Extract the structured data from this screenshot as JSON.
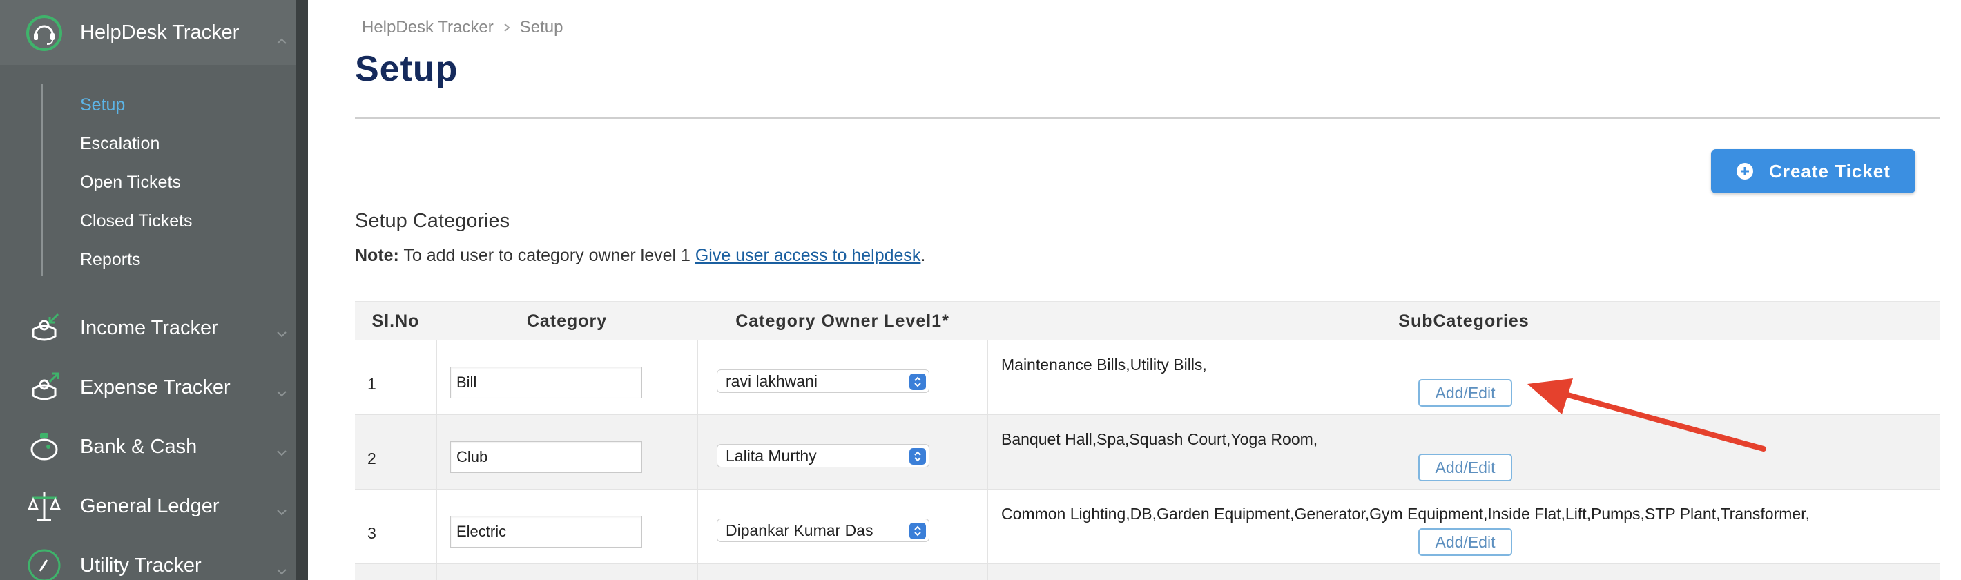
{
  "sidebar": {
    "app": {
      "label": "HelpDesk Tracker",
      "icon": "headset-icon"
    },
    "submenu": [
      {
        "label": "Setup",
        "active": true
      },
      {
        "label": "Escalation",
        "active": false
      },
      {
        "label": "Open Tickets",
        "active": false
      },
      {
        "label": "Closed Tickets",
        "active": false
      },
      {
        "label": "Reports",
        "active": false
      }
    ],
    "items": [
      {
        "label": "Income Tracker",
        "icon": "income-icon"
      },
      {
        "label": "Expense Tracker",
        "icon": "expense-icon"
      },
      {
        "label": "Bank & Cash",
        "icon": "piggy-bank-icon"
      },
      {
        "label": "General Ledger",
        "icon": "scale-icon"
      },
      {
        "label": "Utility Tracker",
        "icon": "gauge-icon"
      }
    ]
  },
  "breadcrumb": {
    "root": "HelpDesk Tracker",
    "current": "Setup"
  },
  "page": {
    "title": "Setup",
    "create_button": "Create Ticket",
    "section_title": "Setup Categories",
    "note_label": "Note:",
    "note_text": "To add user to category owner level 1",
    "note_link": "Give user access to helpdesk",
    "note_end": "."
  },
  "table": {
    "headers": {
      "no": "Sl.No",
      "category": "Category",
      "owner": "Category Owner Level1*",
      "subcategories": "SubCategories"
    },
    "add_edit_label": "Add/Edit",
    "rows": [
      {
        "no": "1",
        "category": "Bill",
        "owner": "ravi lakhwani",
        "subcategories": "Maintenance Bills,Utility Bills,"
      },
      {
        "no": "2",
        "category": "Club",
        "owner": "Lalita Murthy",
        "subcategories": "Banquet Hall,Spa,Squash Court,Yoga Room,"
      },
      {
        "no": "3",
        "category": "Electric",
        "owner": "Dipankar Kumar Das",
        "subcategories": "Common Lighting,DB,Garden Equipment,Generator,Gym Equipment,Inside Flat,Lift,Pumps,STP Plant,Transformer,"
      }
    ]
  },
  "colors": {
    "sidebar": "#5b6162",
    "accent": "#3b8fe1",
    "active_submenu": "#5cb4e6",
    "title": "#152a5c",
    "annotation_arrow": "#e5412d",
    "icon_green": "#3fb36b"
  }
}
